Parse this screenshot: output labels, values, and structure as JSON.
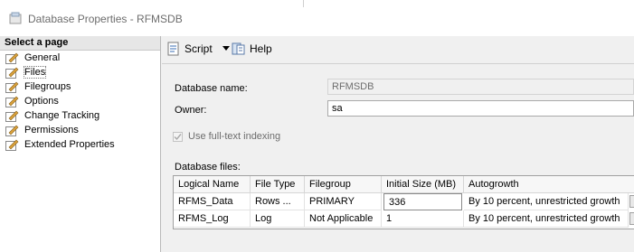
{
  "window": {
    "title": "Database Properties - RFMSDB"
  },
  "select_page": {
    "header": "Select a page",
    "items": [
      {
        "label": "General",
        "selected": false
      },
      {
        "label": "Files",
        "selected": true
      },
      {
        "label": "Filegroups",
        "selected": false
      },
      {
        "label": "Options",
        "selected": false
      },
      {
        "label": "Change Tracking",
        "selected": false
      },
      {
        "label": "Permissions",
        "selected": false
      },
      {
        "label": "Extended Properties",
        "selected": false
      }
    ]
  },
  "toolbar": {
    "script_label": "Script",
    "help_label": "Help"
  },
  "form": {
    "db_name_label": "Database name:",
    "db_name_value": "RFMSDB",
    "owner_label": "Owner:",
    "owner_value": "sa",
    "fulltext_label": "Use full-text indexing",
    "fulltext_checked": true,
    "files_label": "Database files:"
  },
  "files_grid": {
    "columns": [
      "Logical Name",
      "File Type",
      "Filegroup",
      "Initial Size (MB)",
      "Autogrowth"
    ],
    "rows": [
      [
        "RFMS_Data",
        "Rows ...",
        "PRIMARY",
        "336",
        "By 10 percent, unrestricted growth"
      ],
      [
        "RFMS_Log",
        "Log",
        "Not Applicable",
        "1",
        "By 10 percent, unrestricted growth"
      ]
    ]
  },
  "colors": {
    "window_bg": "#f0f0f0",
    "panel_bg": "#ffffff",
    "disabled_text": "#6d6d6d"
  }
}
